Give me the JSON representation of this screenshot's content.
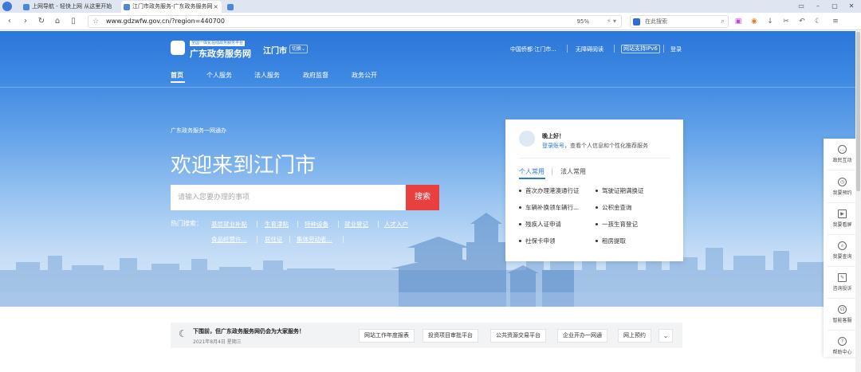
{
  "browser": {
    "tabs": [
      {
        "title": "上网导航 - 轻快上网 从这里开始",
        "active": false
      },
      {
        "title": "江门市政务服务-广东政务服务网",
        "active": true
      }
    ],
    "url": "www.gdzwfw.gov.cn/?region=440700",
    "zoom": "95%",
    "search_placeholder": "在此搜索",
    "window_controls": [
      "▭",
      "–",
      "▢",
      "✕"
    ]
  },
  "header": {
    "logo_sub": "全国一体化在线政务服务平台",
    "site_title": "广东政务服务网",
    "city": "江门市",
    "city_switch": "切换",
    "links": [
      "中国侨都·江门市...",
      "无障碍阅读",
      "网站支持IPv6",
      "登录"
    ],
    "nav": [
      "首页",
      "个人服务",
      "法人服务",
      "政府监督",
      "政务公开"
    ]
  },
  "hero": {
    "slogan": "广东政务服务一网通办",
    "welcome": "欢迎来到江门市",
    "search_placeholder": "请输入您要办理的事项",
    "search_button": "搜索",
    "hot_label": "热门搜索：",
    "hot_row1": [
      "基层就业补贴",
      "生育津贴",
      "特种设备",
      "就业登记",
      "人才入户"
    ],
    "hot_row2": [
      "食品经营许...",
      "居住证",
      "集体劳动者..."
    ]
  },
  "login_card": {
    "greeting": "晚上好！",
    "login_link": "登录账号",
    "login_text": "，查看个人信息和个性化推荐服务",
    "tabs": [
      "个人常用",
      "法人常用"
    ],
    "services": [
      [
        "首次办理港澳通行证",
        "驾驶证期满换证"
      ],
      [
        "车辆补换领车辆行...",
        "公积金查询"
      ],
      [
        "残疾人证申请",
        "一孩生育登记"
      ],
      [
        "社保卡申领",
        "租房提取"
      ]
    ]
  },
  "notice": {
    "text": "下围前，但广东政务服务网仍会为大家服务！",
    "date": "2021年8月4日 星期三",
    "quick_links": [
      "网站工作年度报表",
      "投资项目审批平台",
      "公共资源交易平台",
      "企业开办一网通",
      "网上预约"
    ],
    "more": "⌄"
  },
  "floatbar": [
    {
      "label": "政民互动",
      "icon": "chat-icon"
    },
    {
      "label": "我要预约",
      "icon": "clock-icon"
    },
    {
      "label": "我要看屏",
      "icon": "screen-icon"
    },
    {
      "label": "我要查询",
      "icon": "search-icon"
    },
    {
      "label": "咨询投诉",
      "icon": "message-icon"
    },
    {
      "label": "智能客服",
      "icon": "headset-icon"
    },
    {
      "label": "帮助中心",
      "icon": "help-icon"
    }
  ]
}
